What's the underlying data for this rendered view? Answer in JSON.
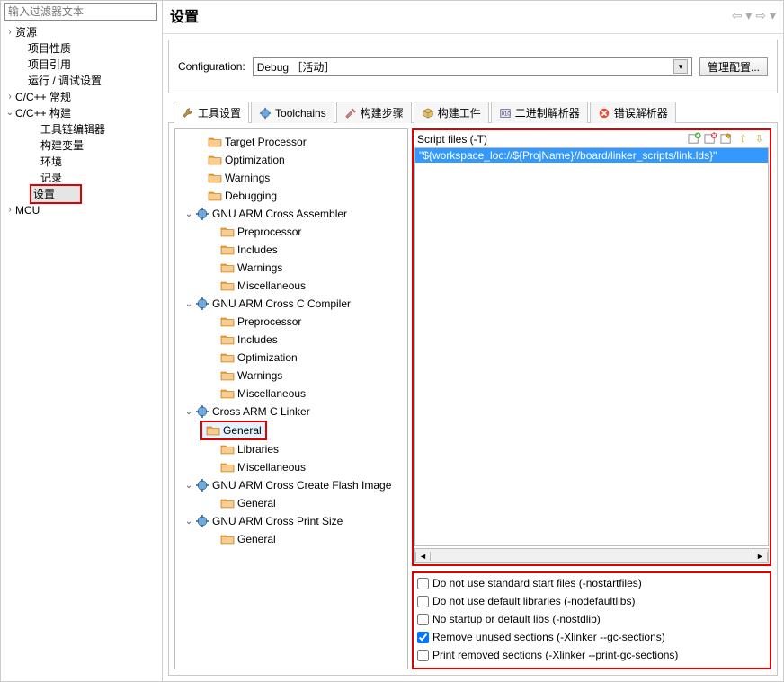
{
  "filter_placeholder": "输入过滤器文本",
  "left_tree": {
    "n0": "资源",
    "n1": "项目性质",
    "n2": "项目引用",
    "n3": "运行 / 调试设置",
    "n4": "C/C++ 常规",
    "n5": "C/C++ 构建",
    "n5a": "工具链编辑器",
    "n5b": "构建变量",
    "n5c": "环境",
    "n5d": "记录",
    "n5e": "设置",
    "n6": "MCU"
  },
  "title": "设置",
  "config_label": "Configuration:",
  "config_value": "Debug ［活动］",
  "manage_btn": "管理配置...",
  "tabs": {
    "tool": "工具设置",
    "toolchains": "Toolchains",
    "steps": "构建步骤",
    "artifact": "构建工件",
    "binary": "二进制解析器",
    "error": "错误解析器"
  },
  "tool_tree": {
    "t0": "Target Processor",
    "t1": "Optimization",
    "t2": "Warnings",
    "t3": "Debugging",
    "asm": "GNU ARM Cross Assembler",
    "asm0": "Preprocessor",
    "asm1": "Includes",
    "asm2": "Warnings",
    "asm3": "Miscellaneous",
    "cc": "GNU ARM Cross C Compiler",
    "cc0": "Preprocessor",
    "cc1": "Includes",
    "cc2": "Optimization",
    "cc3": "Warnings",
    "cc4": "Miscellaneous",
    "ld": "Cross ARM C Linker",
    "ld0": "General",
    "ld1": "Libraries",
    "ld2": "Miscellaneous",
    "fl": "GNU ARM Cross Create Flash Image",
    "fl0": "General",
    "ps": "GNU ARM Cross Print Size",
    "ps0": "General"
  },
  "script_title": "Script files (-T)",
  "script_item": "\"${workspace_loc://${ProjName}//board/linker_scripts/link.lds}\"",
  "checks": {
    "c0": "Do not use standard start files (-nostartfiles)",
    "c1": "Do not use default libraries (-nodefaultlibs)",
    "c2": "No startup or default libs (-nostdlib)",
    "c3": "Remove unused sections (-Xlinker --gc-sections)",
    "c4": "Print removed sections (-Xlinker --print-gc-sections)"
  }
}
